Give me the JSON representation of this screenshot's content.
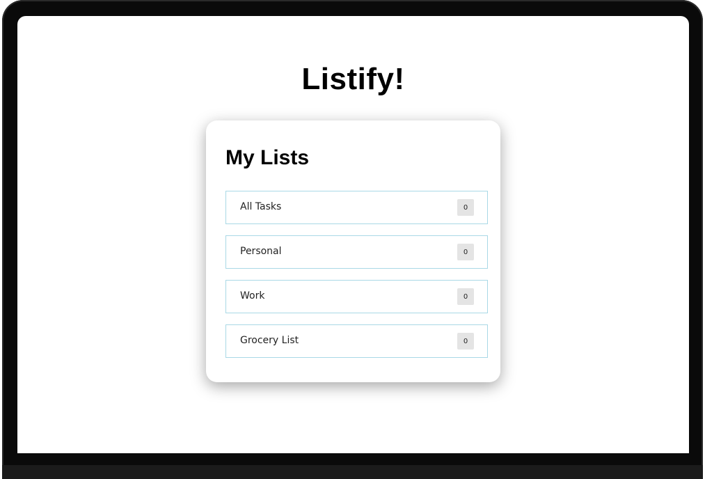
{
  "app": {
    "title": "Listify!"
  },
  "card": {
    "title": "My Lists"
  },
  "lists": [
    {
      "label": "All Tasks",
      "count": "0"
    },
    {
      "label": "Personal",
      "count": "0"
    },
    {
      "label": "Work",
      "count": "0"
    },
    {
      "label": "Grocery List",
      "count": "0"
    }
  ],
  "colors": {
    "item_border": "#a9d8e6",
    "badge_bg": "#e4e4e4",
    "bezel": "#0a0a0a"
  }
}
